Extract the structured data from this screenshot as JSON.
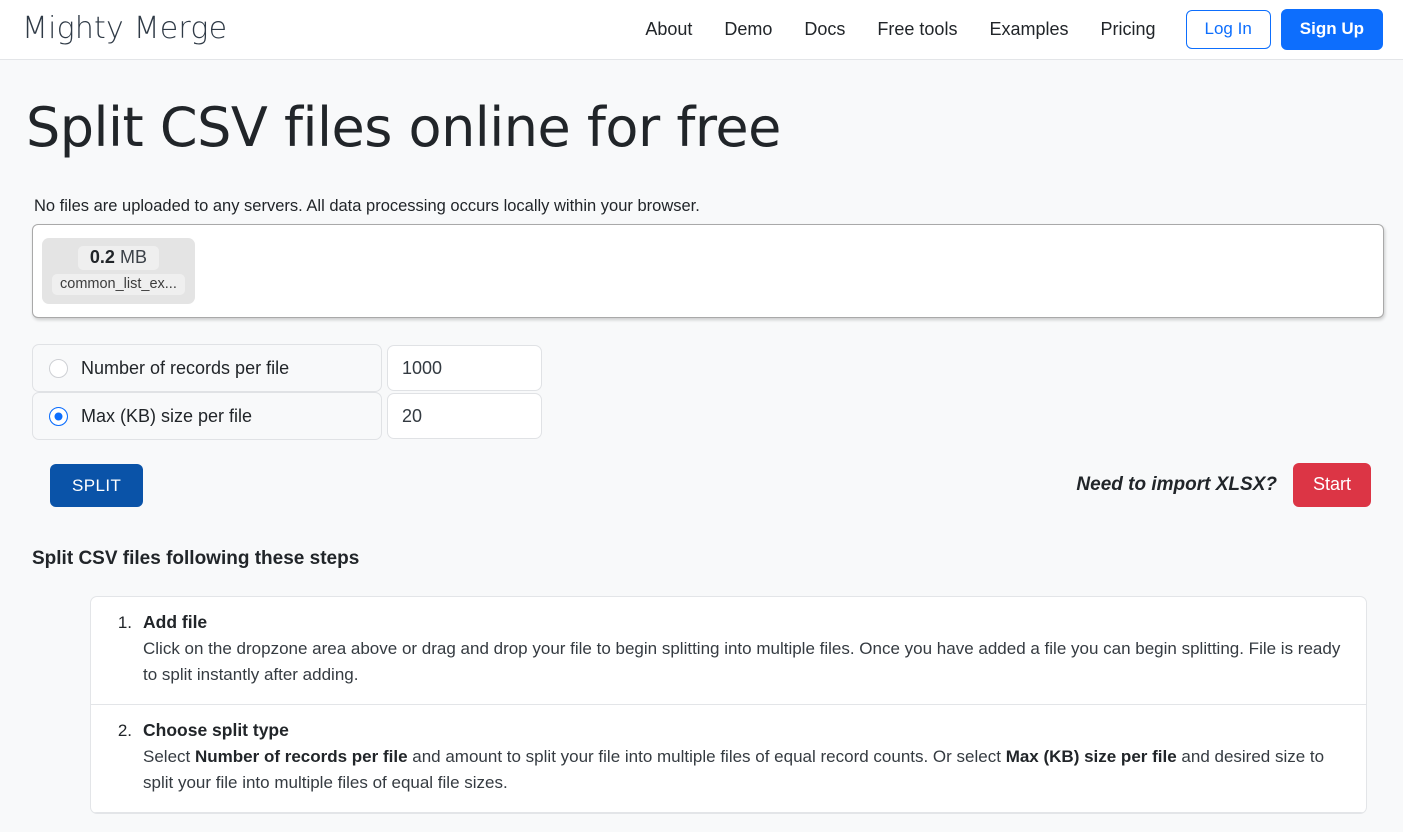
{
  "header": {
    "brand": "Mighty Merge",
    "nav": [
      {
        "label": "About"
      },
      {
        "label": "Demo"
      },
      {
        "label": "Docs"
      },
      {
        "label": "Free tools"
      },
      {
        "label": "Examples"
      },
      {
        "label": "Pricing"
      }
    ],
    "login_label": "Log In",
    "signup_label": "Sign Up",
    "accent_color": "#0d6efd"
  },
  "main": {
    "title": "Split CSV files online for free",
    "privacy_note": "No files are uploaded to any servers. All data processing occurs locally within your browser.",
    "dropzone": {
      "file": {
        "size_value": "0.2",
        "size_unit": "MB",
        "name": "common_list_ex..."
      }
    },
    "options": [
      {
        "label": "Number of records per file",
        "selected": false,
        "value": "1000",
        "placeholder": "Number of records"
      },
      {
        "label": "Max (KB) size per file",
        "selected": true,
        "value": "20",
        "placeholder": "Max KB size"
      }
    ],
    "split_button": "SPLIT",
    "xlsx_cta_text": "Need to import XLSX?",
    "xlsx_start_button": "Start",
    "split_button_color": "#0a53a8",
    "start_button_color": "#dc3545"
  },
  "steps": {
    "title": "Split CSV files following these steps",
    "items": [
      {
        "num": "1.",
        "head": "Add file",
        "text_part1": "Click on the dropzone area above or drag and drop your file to begin splitting into multiple files. Once you have added a file you can begin splitting. File is ready to split instantly after adding."
      },
      {
        "num": "2.",
        "head": "Choose split type",
        "text_a": "Select ",
        "text_b": "Number of records per file",
        "text_c": " and amount to split your file into multiple files of equal record counts. Or select ",
        "text_d": "Max (KB) size per file",
        "text_e": " and desired size to split your file into multiple files of equal file sizes."
      }
    ]
  }
}
